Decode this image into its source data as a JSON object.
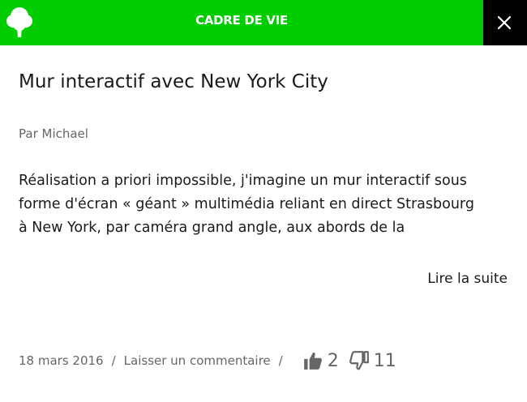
{
  "header": {
    "category": "CADRE DE VIE",
    "close_label": "X",
    "accent_color": "#00cc00",
    "icons": [
      "tree-icon",
      "close-icon"
    ]
  },
  "article": {
    "title": "Mur interactif avec New York City",
    "author": "Par Michael",
    "excerpt_lines": [
      "Réalisation a priori impossible, j'imagine un mur interactif sous",
      "forme d'écran « géant » multimédia reliant en direct Strasbourg",
      "à New York, par caméra grand angle, aux abords de la"
    ],
    "read_more": "Lire la suite"
  },
  "footer": {
    "date": "18 mars 2016",
    "separator": "/",
    "comment_link": "Laisser un commentaire",
    "upvotes": "2",
    "downvotes": "11",
    "icons": [
      "thumbs-up-icon",
      "thumbs-down-icon"
    ]
  }
}
